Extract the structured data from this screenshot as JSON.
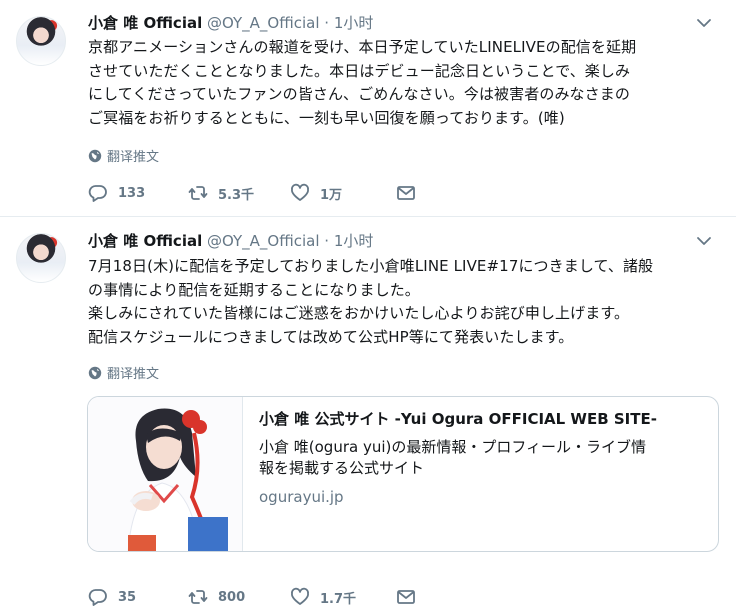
{
  "tweets": [
    {
      "author_name": "小倉 唯 Official",
      "handle": "@OY_A_Official",
      "separator": "·",
      "time": "1小时",
      "text": "京都アニメーションさんの報道を受け、本日予定していたLINELIVEの配信を延期\nさせていただくこととなりました。本日はデビュー記念日ということで、楽しみ\nにしてくださっていたファンの皆さん、ごめんなさい。今は被害者のみなさまの\nご冥福をお祈りするとともに、一刻も早い回復を願っております。(唯)",
      "translate_label": "翻译推文",
      "replies": "133",
      "retweets": "5.3千",
      "likes": "1万"
    },
    {
      "author_name": "小倉 唯 Official",
      "handle": "@OY_A_Official",
      "separator": "·",
      "time": "1小时",
      "text": "7月18日(木)に配信を予定しておりました小倉唯LINE LIVE#17につきまして、諸般\nの事情により配信を延期することになりました。\n楽しみにされていた皆様にはご迷惑をおかけいたし心よりお詫び申し上げます。\n配信スケジュールにつきましては改めて公式HP等にて発表いたします。",
      "translate_label": "翻译推文",
      "replies": "35",
      "retweets": "800",
      "likes": "1.7千",
      "card": {
        "title": "小倉 唯 公式サイト -Yui Ogura OFFICIAL WEB SITE-",
        "description": "小倉 唯(ogura yui)の最新情報・プロフィール・ライブ情\n報を掲載する公式サイト",
        "domain": "ogurayui.jp"
      }
    }
  ],
  "icons": {
    "reply": "reply-icon",
    "retweet": "retweet-icon",
    "like": "heart-icon",
    "share": "mail-icon",
    "translate": "globe-icon",
    "menu": "chevron-down-icon"
  },
  "colors": {
    "text": "#14171a",
    "secondary": "#657786",
    "border": "#e6ecf0",
    "card_border": "#ccd6dd"
  }
}
